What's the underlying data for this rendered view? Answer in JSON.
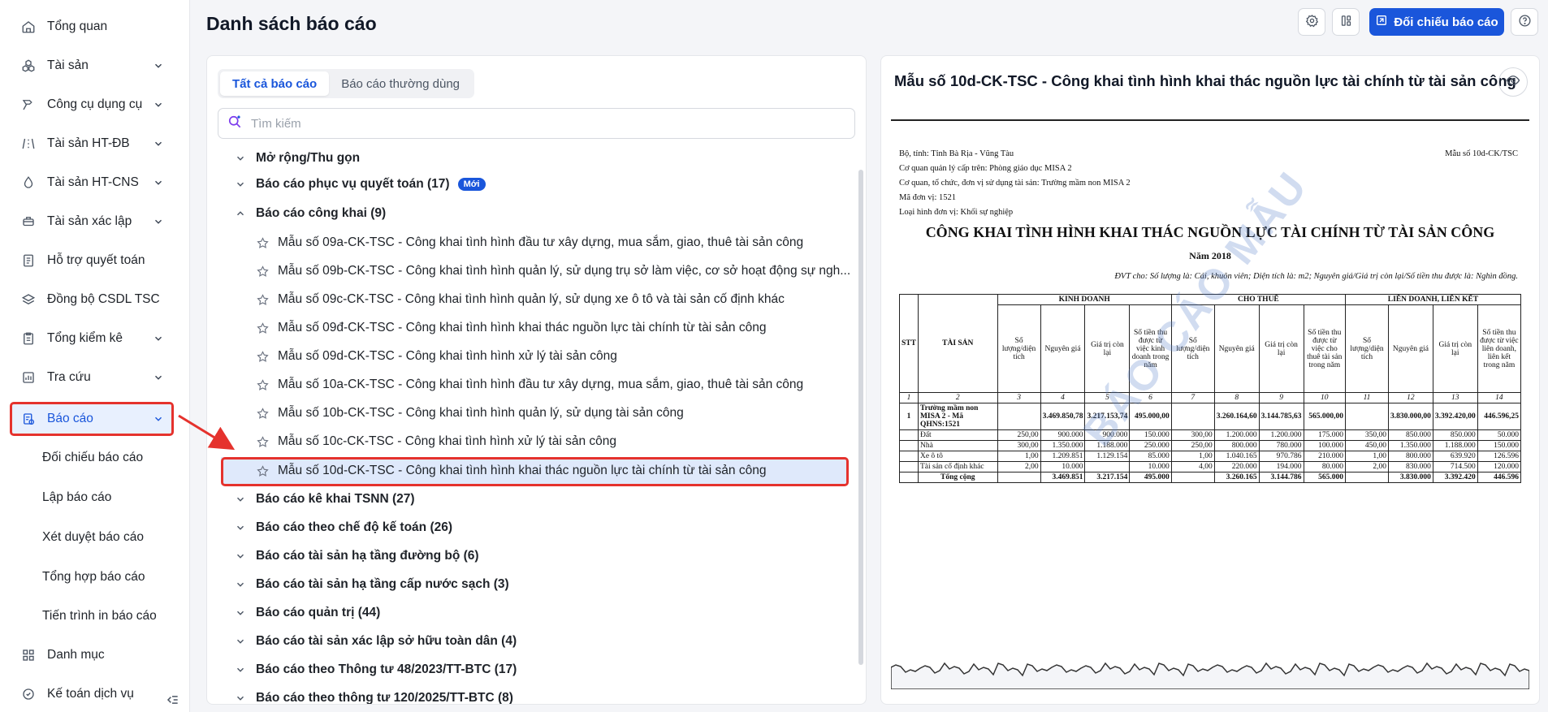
{
  "sidebar": {
    "items": [
      {
        "label": "Tổng quan",
        "icon": "home-icon",
        "chevron": false
      },
      {
        "label": "Tài sản",
        "icon": "boxes-icon",
        "chevron": true
      },
      {
        "label": "Công cụ dụng cụ",
        "icon": "hammer-icon",
        "chevron": true
      },
      {
        "label": "Tài sản HT-ĐB",
        "icon": "road-icon",
        "chevron": true
      },
      {
        "label": "Tài sản HT-CNS",
        "icon": "water-drop-icon",
        "chevron": true
      },
      {
        "label": "Tài sản xác lập",
        "icon": "gavel-icon",
        "chevron": true
      },
      {
        "label": "Hỗ trợ quyết toán",
        "icon": "document-icon",
        "chevron": false
      },
      {
        "label": "Đồng bộ CSDL TSC",
        "icon": "layers-icon",
        "chevron": false
      },
      {
        "label": "Tổng kiểm kê",
        "icon": "clipboard-icon",
        "chevron": true
      },
      {
        "label": "Tra cứu",
        "icon": "chart-icon",
        "chevron": true
      },
      {
        "label": "Báo cáo",
        "icon": "report-icon",
        "chevron": true
      }
    ],
    "report_subitems": [
      "Đối chiếu báo cáo",
      "Lập báo cáo",
      "Xét duyệt báo cáo",
      "Tổng hợp báo cáo",
      "Tiến trình in báo cáo"
    ],
    "bottom_items": [
      {
        "label": "Danh mục",
        "icon": "grid-icon"
      },
      {
        "label": "Kế toán dịch vụ",
        "icon": "accounting-icon"
      }
    ]
  },
  "header": {
    "title": "Danh sách báo cáo",
    "compare_button": "Đối chiếu báo cáo"
  },
  "left_panel": {
    "tabs": [
      "Tất cả báo cáo",
      "Báo cáo thường dùng"
    ],
    "search_placeholder": "Tìm kiếm",
    "expand_collapse": "Mở rộng/Thu gọn",
    "groups_top": [
      {
        "label": "Báo cáo phục vụ quyết toán (17)",
        "badge": "Mới"
      },
      {
        "label": "Báo cáo công khai (9)"
      }
    ],
    "public_reports": [
      "Mẫu số 09a-CK-TSC - Công khai tình hình đầu tư xây dựng, mua sắm, giao, thuê tài sản công",
      "Mẫu số 09b-CK-TSC - Công khai tình hình quản lý, sử dụng trụ sở làm việc, cơ sở hoạt động sự ngh...",
      "Mẫu số 09c-CK-TSC - Công khai tình hình quản lý, sử dụng xe ô tô và tài sản cố định khác",
      "Mẫu số 09đ-CK-TSC - Công khai tình hình khai thác nguồn lực tài chính từ tài sản công",
      "Mẫu số 09d-CK-TSC - Công khai tình hình xử lý tài sản công",
      "Mẫu số 10a-CK-TSC - Công khai tình hình đầu tư xây dựng, mua sắm, giao, thuê tài sản công",
      "Mẫu số 10b-CK-TSC - Công khai tình hình quản lý, sử dụng tài sản công",
      "Mẫu số 10c-CK-TSC - Công khai tình hình xử lý tài sản công",
      "Mẫu số 10d-CK-TSC - Công khai tình hình khai thác nguồn lực tài chính từ tài sản công"
    ],
    "groups_bottom": [
      "Báo cáo kê khai TSNN (27)",
      "Báo cáo theo chế độ kế toán (26)",
      "Báo cáo tài sản hạ tầng đường bộ (6)",
      "Báo cáo tài sản hạ tầng cấp nước sạch (3)",
      "Báo cáo quản trị (44)",
      "Báo cáo tài sản xác lập sở hữu toàn dân (4)",
      "Báo cáo theo Thông tư 48/2023/TT-BTC (17)",
      "Báo cáo theo thông tư 120/2025/TT-BTC (8)"
    ]
  },
  "preview": {
    "title": "Mẫu số 10d-CK-TSC - Công khai tình hình khai thác nguồn lực tài chính từ tài sản công",
    "doc": {
      "meta": [
        "Bộ, tỉnh: Tỉnh Bà Rịa - Vũng Tàu",
        "Cơ quan quản lý cấp trên: Phòng giáo dục MISA 2",
        "Cơ quan, tổ chức, đơn vị sử dụng tài sản: Trường mầm non MISA 2",
        "Mã đơn vị: 1521",
        "Loại hình đơn vị: Khối sự nghiệp"
      ],
      "form_no": "Mẫu số 10d-CK/TSC",
      "title": "CÔNG KHAI TÌNH HÌNH KHAI THÁC NGUỒN LỰC TÀI CHÍNH TỪ TÀI SẢN CÔNG",
      "year": "Năm 2018",
      "unit": "ĐVT cho: Số lượng là: Cái, khuôn viên; Diện tích là: m2; Nguyên giá/Giá trị còn lại/Số tiền thu được là: Nghìn đồng.",
      "watermark": "BÁO CÁO MẪU",
      "head": {
        "stt": "STT",
        "asset": "TÀI SẢN",
        "groups": [
          "KINH DOANH",
          "CHO THUÊ",
          "LIÊN DOANH, LIÊN KẾT"
        ],
        "cols": [
          [
            "Số lượng/diện tích",
            "Nguyên giá",
            "Giá trị còn lại",
            "Số tiền thu được từ việc kinh doanh trong năm"
          ],
          [
            "Số lượng/diện tích",
            "Nguyên giá",
            "Giá trị còn lại",
            "Số tiền thu được từ việc cho thuê tài sản trong năm"
          ],
          [
            "Số lượng/diện tích",
            "Nguyên giá",
            "Giá trị còn lại",
            "Số tiền thu được từ việc liên doanh, liên kết trong năm"
          ]
        ],
        "index": [
          "1",
          "2",
          "3",
          "4",
          "5",
          "6",
          "7",
          "8",
          "9",
          "10",
          "11",
          "12",
          "13",
          "14"
        ]
      },
      "rows": [
        {
          "stt": "1",
          "name": "Trường mầm non MISA 2 - Mã QHNS:1521",
          "bold": true,
          "v": [
            "",
            "3.469.850,78",
            "3.217.153,74",
            "495.000,00",
            "",
            "3.260.164,60",
            "3.144.785,63",
            "565.000,00",
            "",
            "3.830.000,00",
            "3.392.420,00",
            "446.596,25"
          ]
        },
        {
          "stt": "",
          "name": "Đất",
          "bold": false,
          "v": [
            "250,00",
            "900.000",
            "900.000",
            "150.000",
            "300,00",
            "1.200.000",
            "1.200.000",
            "175.000",
            "350,00",
            "850.000",
            "850.000",
            "50.000"
          ]
        },
        {
          "stt": "",
          "name": "Nhà",
          "bold": false,
          "v": [
            "300,00",
            "1.350.000",
            "1.188.000",
            "250.000",
            "250,00",
            "800.000",
            "780.000",
            "100.000",
            "450,00",
            "1.350.000",
            "1.188.000",
            "150.000"
          ]
        },
        {
          "stt": "",
          "name": "Xe ô tô",
          "bold": false,
          "v": [
            "1,00",
            "1.209.851",
            "1.129.154",
            "85.000",
            "1,00",
            "1.040.165",
            "970.786",
            "210.000",
            "1,00",
            "800.000",
            "639.920",
            "126.596"
          ]
        },
        {
          "stt": "",
          "name": "Tài sản cố định khác",
          "bold": false,
          "v": [
            "2,00",
            "10.000",
            "",
            "10.000",
            "4,00",
            "220.000",
            "194.000",
            "80.000",
            "2,00",
            "830.000",
            "714.500",
            "120.000"
          ]
        },
        {
          "stt": "",
          "name": "Tổng cộng",
          "bold": true,
          "v": [
            "",
            "3.469.851",
            "3.217.154",
            "495.000",
            "",
            "3.260.165",
            "3.144.786",
            "565.000",
            "",
            "3.830.000",
            "3.392.420",
            "446.596"
          ]
        }
      ]
    }
  },
  "colors": {
    "accent": "#1a56db",
    "highlight": "#e5322d",
    "selected_bg": "#dfe9fb"
  }
}
